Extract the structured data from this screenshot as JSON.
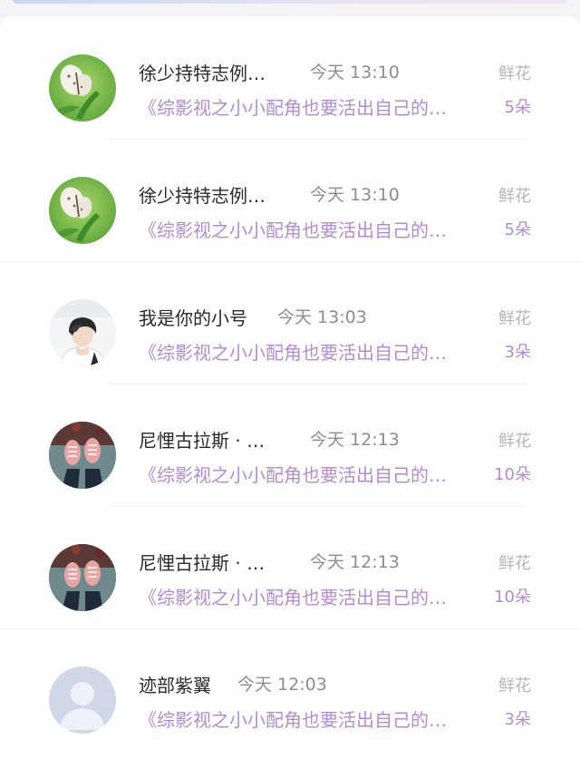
{
  "records": [
    {
      "avatar_icon": "butterfly-avatar-icon",
      "name": "徐少持特志例…",
      "time": "今天 13:10",
      "book": "《综影视之小小配角也要活出自己的…",
      "gift_label": "鲜花",
      "gift_count": "5朵"
    },
    {
      "avatar_icon": "butterfly-avatar-icon",
      "name": "徐少持特志例…",
      "time": "今天 13:10",
      "book": "《综影视之小小配角也要活出自己的…",
      "gift_label": "鲜花",
      "gift_count": "5朵"
    },
    {
      "avatar_icon": "boy-portrait-avatar-icon",
      "name": "我是你的小号",
      "time": "今天 13:03",
      "book": "《综影视之小小配角也要活出自己的…",
      "gift_label": "鲜花",
      "gift_count": "3朵"
    },
    {
      "avatar_icon": "sneakers-avatar-icon",
      "name": "尼悝古拉斯 · …",
      "time": "今天 12:13",
      "book": "《综影视之小小配角也要活出自己的…",
      "gift_label": "鲜花",
      "gift_count": "10朵"
    },
    {
      "avatar_icon": "sneakers-avatar-icon",
      "name": "尼悝古拉斯 · …",
      "time": "今天 12:13",
      "book": "《综影视之小小配角也要活出自己的…",
      "gift_label": "鲜花",
      "gift_count": "10朵"
    },
    {
      "avatar_icon": "default-user-avatar-icon",
      "name": "迹部紫翼",
      "time": "今天 12:03",
      "book": "《综影视之小小配角也要活出自己的…",
      "gift_label": "鲜花",
      "gift_count": "3朵"
    }
  ],
  "colors": {
    "name": "#2a2a2e",
    "time": "#8c8c92",
    "accent": "#b38bd3",
    "gift_label": "#b5b5ba"
  }
}
